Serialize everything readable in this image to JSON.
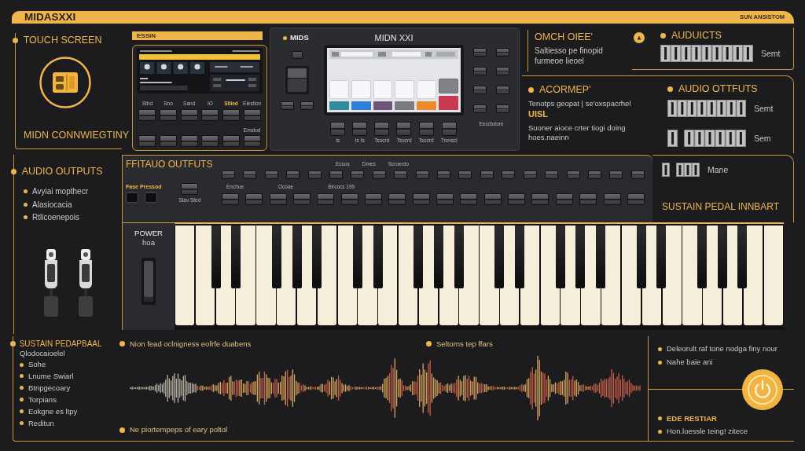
{
  "header": {
    "title": "MIDASXXI",
    "tag": "SUN ANSISTOM"
  },
  "touch_panel": {
    "heading": "TOUCH SCREEN",
    "caption": "MIDN CONNWIEGTINY"
  },
  "left_device": {
    "label": "ESSIN",
    "buttons": [
      {
        "label": "Sthd",
        "highlighted": false
      },
      {
        "label": "Sno",
        "highlighted": false
      },
      {
        "label": "Sand",
        "highlighted": false
      },
      {
        "label": "IO",
        "highlighted": false
      },
      {
        "label": "Stlled",
        "highlighted": true
      },
      {
        "label": "Elestion",
        "highlighted": false
      }
    ],
    "lower_label": "Emslod"
  },
  "center_device": {
    "callout": "MIDS",
    "title": "MIDN XXI",
    "screen_tiles": [
      {
        "color": "#2f8a99"
      },
      {
        "color": "#2f7fd6"
      },
      {
        "color": "#6d5479"
      },
      {
        "color": "#7a7a80"
      },
      {
        "color": "#ef8a2a"
      },
      {
        "color": "#c9394f"
      }
    ],
    "bottom_labels": [
      "Is",
      "Is Is",
      "Tsocrd",
      "Tsocrd",
      "Tsocrd",
      "Tronscl"
    ],
    "side_label": "Eecctutore"
  },
  "right_top": {
    "heading": "OMCH OIEE'",
    "body": "Saltiesso pe finopid furmeoe lieoel"
  },
  "auduicts": {
    "heading": "AUDUICTS",
    "strip_label": "Semt"
  },
  "acormep": {
    "heading": "ACORMEP'",
    "line1": "Tenotps geopat | se'oxspacrhel",
    "emphasis": "UISL",
    "line2": "Suoner aioce crter tiogi doing hoes.naeinn"
  },
  "audio_ottfuts": {
    "heading": "AUDIO OTTFUTS",
    "strips": [
      {
        "label": "Semt"
      },
      {
        "label": "Sem"
      }
    ]
  },
  "sustain_panel": {
    "strip_label": "Mane",
    "heading": "SUSTAIN PEDAL INNBART"
  },
  "audio_outputs": {
    "heading": "AUDIO OUTPUTS",
    "bullets": [
      "Avyiai mopthecr",
      "Alasiocacia",
      "Rtlicoenepois"
    ]
  },
  "keyboard": {
    "label": "FFITAUO OUTFUTS",
    "preset_label": "Fase Pressod",
    "slave_label": "Slav Sted",
    "top_labels": [
      "Ecsos",
      "Dmes",
      "Scroerdo"
    ],
    "mid_labels": [
      "Enchue",
      "Ocoae",
      "Bircocs 199"
    ],
    "power_label": "POWER",
    "power_sub": "hoa"
  },
  "sustain_list": {
    "heading": "SUSTAIN PEDAPBAAL",
    "subheading": "Qlodocaioelel",
    "bullets": [
      "Sohe",
      "Lnume Swiarl",
      "Btnpgecoary",
      "Torpians",
      "Eokgne es ltpy",
      "Reditun"
    ]
  },
  "waveform_panel": {
    "top_note": "Nion fead oclnigness eofrfe duabens",
    "mid_note": "Seltorns tep ffars",
    "bottom_note": "Ne piortempeps of eary poltol"
  },
  "reset_panel": {
    "bullets": [
      "Deleorult raf tone nodga finy nour",
      "Nahe baie ani"
    ],
    "heading": "EDE RESTIAR",
    "note": "Hon.loessle teing! zitece"
  }
}
